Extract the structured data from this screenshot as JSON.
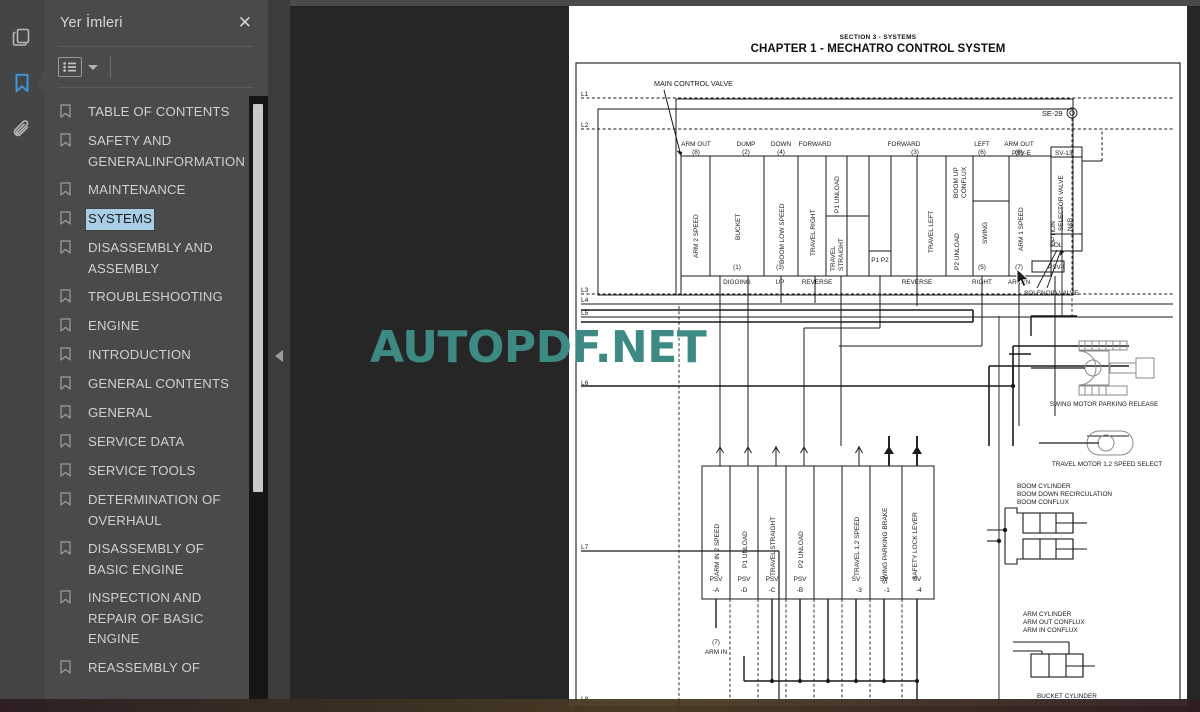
{
  "rail": {
    "items": [
      {
        "name": "thumbnails-icon",
        "label": "Sayfa Küçük Resimleri",
        "active": false
      },
      {
        "name": "bookmark-icon",
        "label": "Yer İmleri",
        "active": true
      },
      {
        "name": "attachment-icon",
        "label": "Ekler",
        "active": false
      }
    ]
  },
  "panel": {
    "title": "Yer İmleri",
    "close_label": "✕",
    "list_view_label": "Liste Görünümü",
    "caret_label": "▾"
  },
  "bookmarks": [
    {
      "label": "TABLE OF CONTENTS",
      "selected": false
    },
    {
      "label": "SAFETY AND GENERALINFORMATION",
      "selected": false
    },
    {
      "label": "MAINTENANCE",
      "selected": false
    },
    {
      "label": "SYSTEMS",
      "selected": true
    },
    {
      "label": "DISASSEMBLY AND ASSEMBLY",
      "selected": false
    },
    {
      "label": "TROUBLESHOOTING",
      "selected": false
    },
    {
      "label": "ENGINE",
      "selected": false
    },
    {
      "label": "INTRODUCTION",
      "selected": false
    },
    {
      "label": "GENERAL CONTENTS",
      "selected": false
    },
    {
      "label": "GENERAL",
      "selected": false
    },
    {
      "label": "SERVICE DATA",
      "selected": false
    },
    {
      "label": "SERVICE TOOLS",
      "selected": false
    },
    {
      "label": "DETERMINATION OF OVERHAUL",
      "selected": false
    },
    {
      "label": "DISASSEMBLY OF BASIC ENGINE",
      "selected": false
    },
    {
      "label": "INSPECTION AND REPAIR OF BASIC ENGINE",
      "selected": false
    },
    {
      "label": "REASSEMBLY OF",
      "selected": false
    }
  ],
  "document": {
    "section": "SECTION 3 - SYSTEMS",
    "chapter": "CHAPTER 1 - MECHATRO CONTROL SYSTEM",
    "page_ref": "SE-29",
    "main_title": "MAIN CONTROL VALVE",
    "solenoid_valve_label": "SOLENOID VALVE",
    "rail_labels": [
      "L1",
      "L2",
      "L3",
      "L4",
      "L5",
      "L6",
      "L7",
      "L8"
    ],
    "valve_top_labels": [
      {
        "text": "ARM OUT",
        "num": "(8)"
      },
      {
        "text": "DUMP",
        "num": "(2)"
      },
      {
        "text": "DOWN",
        "num": "(4)"
      },
      {
        "text": "FORWARD",
        "num": ""
      },
      {
        "text": "FORWARD",
        "num": "(3)"
      },
      {
        "text": "LEFT",
        "num": "(6)"
      },
      {
        "text": "ARM OUT",
        "num": "(8)"
      }
    ],
    "valve_spools": [
      "ARM 2 SPEED",
      "BUCKET",
      "BOOM LOW SPEED",
      "TRAVEL RIGHT",
      "P1 UNLOAD",
      "TRAVEL STRAIGHT",
      "TRAVEL LEFT",
      "BOOM UP CONFLUX",
      "P2 UNLOAD",
      "SWING",
      "ARM 1 SPEED",
      "OPTION"
    ],
    "valve_bottom_labels": [
      {
        "num": "(1)",
        "text": "DIGGING"
      },
      {
        "num": "(3)",
        "text": "UP"
      },
      {
        "num": "",
        "text": "REVERSE"
      },
      {
        "num": "",
        "text": "REVERSE"
      },
      {
        "num": "(5)",
        "text": "RIGHT"
      },
      {
        "num": "(7)",
        "text": "ARM IN"
      }
    ],
    "port_labels": [
      "P1 P2",
      "P1",
      "P2"
    ],
    "psv_e": "PSV-E",
    "psv_i": "PSV-I",
    "sv_13": "SV-13",
    "nb_selector": "N&B SELECTOR VALVE",
    "sol_label": "SOL",
    "pilot_blocks": [
      {
        "name": "ARM IN 2 SPEED",
        "tag": "PSV",
        "sub": "-A"
      },
      {
        "name": "P1 UNLOAD",
        "tag": "PSV",
        "sub": "-D"
      },
      {
        "name": "TRAVEL STRAIGHT",
        "tag": "PSV",
        "sub": "-C"
      },
      {
        "name": "P2 UNLOAD",
        "tag": "PSV",
        "sub": "-B"
      },
      {
        "name": "",
        "tag": "",
        "sub": ""
      },
      {
        "name": "TRAVEL 1,2 SPEED",
        "tag": "SV",
        "sub": "-3"
      },
      {
        "name": "SWING PARKING BRAKE",
        "tag": "SV",
        "sub": "-1"
      },
      {
        "name": "SAFETY LOCK LEVER",
        "tag": "SV",
        "sub": "-4"
      }
    ],
    "pilot_footnote_num": "(7)",
    "pilot_footnote_text": "ARM IN",
    "right_components": [
      {
        "label": "SWING MOTOR PARKING RELEASE"
      },
      {
        "label": "TRAVEL MOTOR 1,2 SPEED SELECT"
      },
      {
        "label": "BOOM CYLINDER\nBOOM DOWN RECIRCULATION\nBOOM CONFLUX"
      },
      {
        "label": "ARM CYLINDER\nARM OUT CONFLUX\nARM IN CONFLUX"
      },
      {
        "label": "BUCKET CYLINDER"
      }
    ],
    "right_component_lines": {
      "swing": "SWING MOTOR PARKING RELEASE",
      "travel": "TRAVEL MOTOR 1,2 SPEED SELECT",
      "boom1": "BOOM CYLINDER",
      "boom2": "BOOM DOWN RECIRCULATION",
      "boom3": "BOOM CONFLUX",
      "arm1": "ARM CYLINDER",
      "arm2": "ARM OUT CONFLUX",
      "arm3": "ARM IN CONFLUX",
      "bucket1": "BUCKET CYLINDER"
    }
  },
  "watermark": {
    "text": "AUTOPDF.NET",
    "color": "#3d8a84"
  }
}
